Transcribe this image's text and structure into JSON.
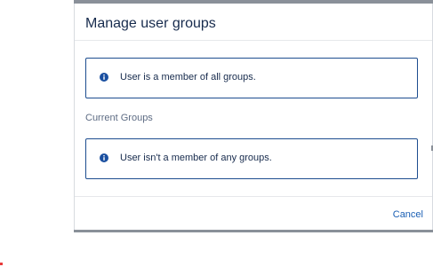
{
  "dialog": {
    "title": "Manage user groups",
    "messages": [
      {
        "icon": "info-icon",
        "text": "User is a member of all groups."
      },
      {
        "icon": "info-icon",
        "text": "User isn't a member of any groups."
      }
    ],
    "current_groups_label": "Current Groups",
    "cancel_label": "Cancel"
  },
  "colors": {
    "title": "#172b4d",
    "info_icon": "#1a4fa0",
    "message_border": "#1d4d8f",
    "link": "#1a5fb4",
    "muted": "#5e6c84"
  }
}
